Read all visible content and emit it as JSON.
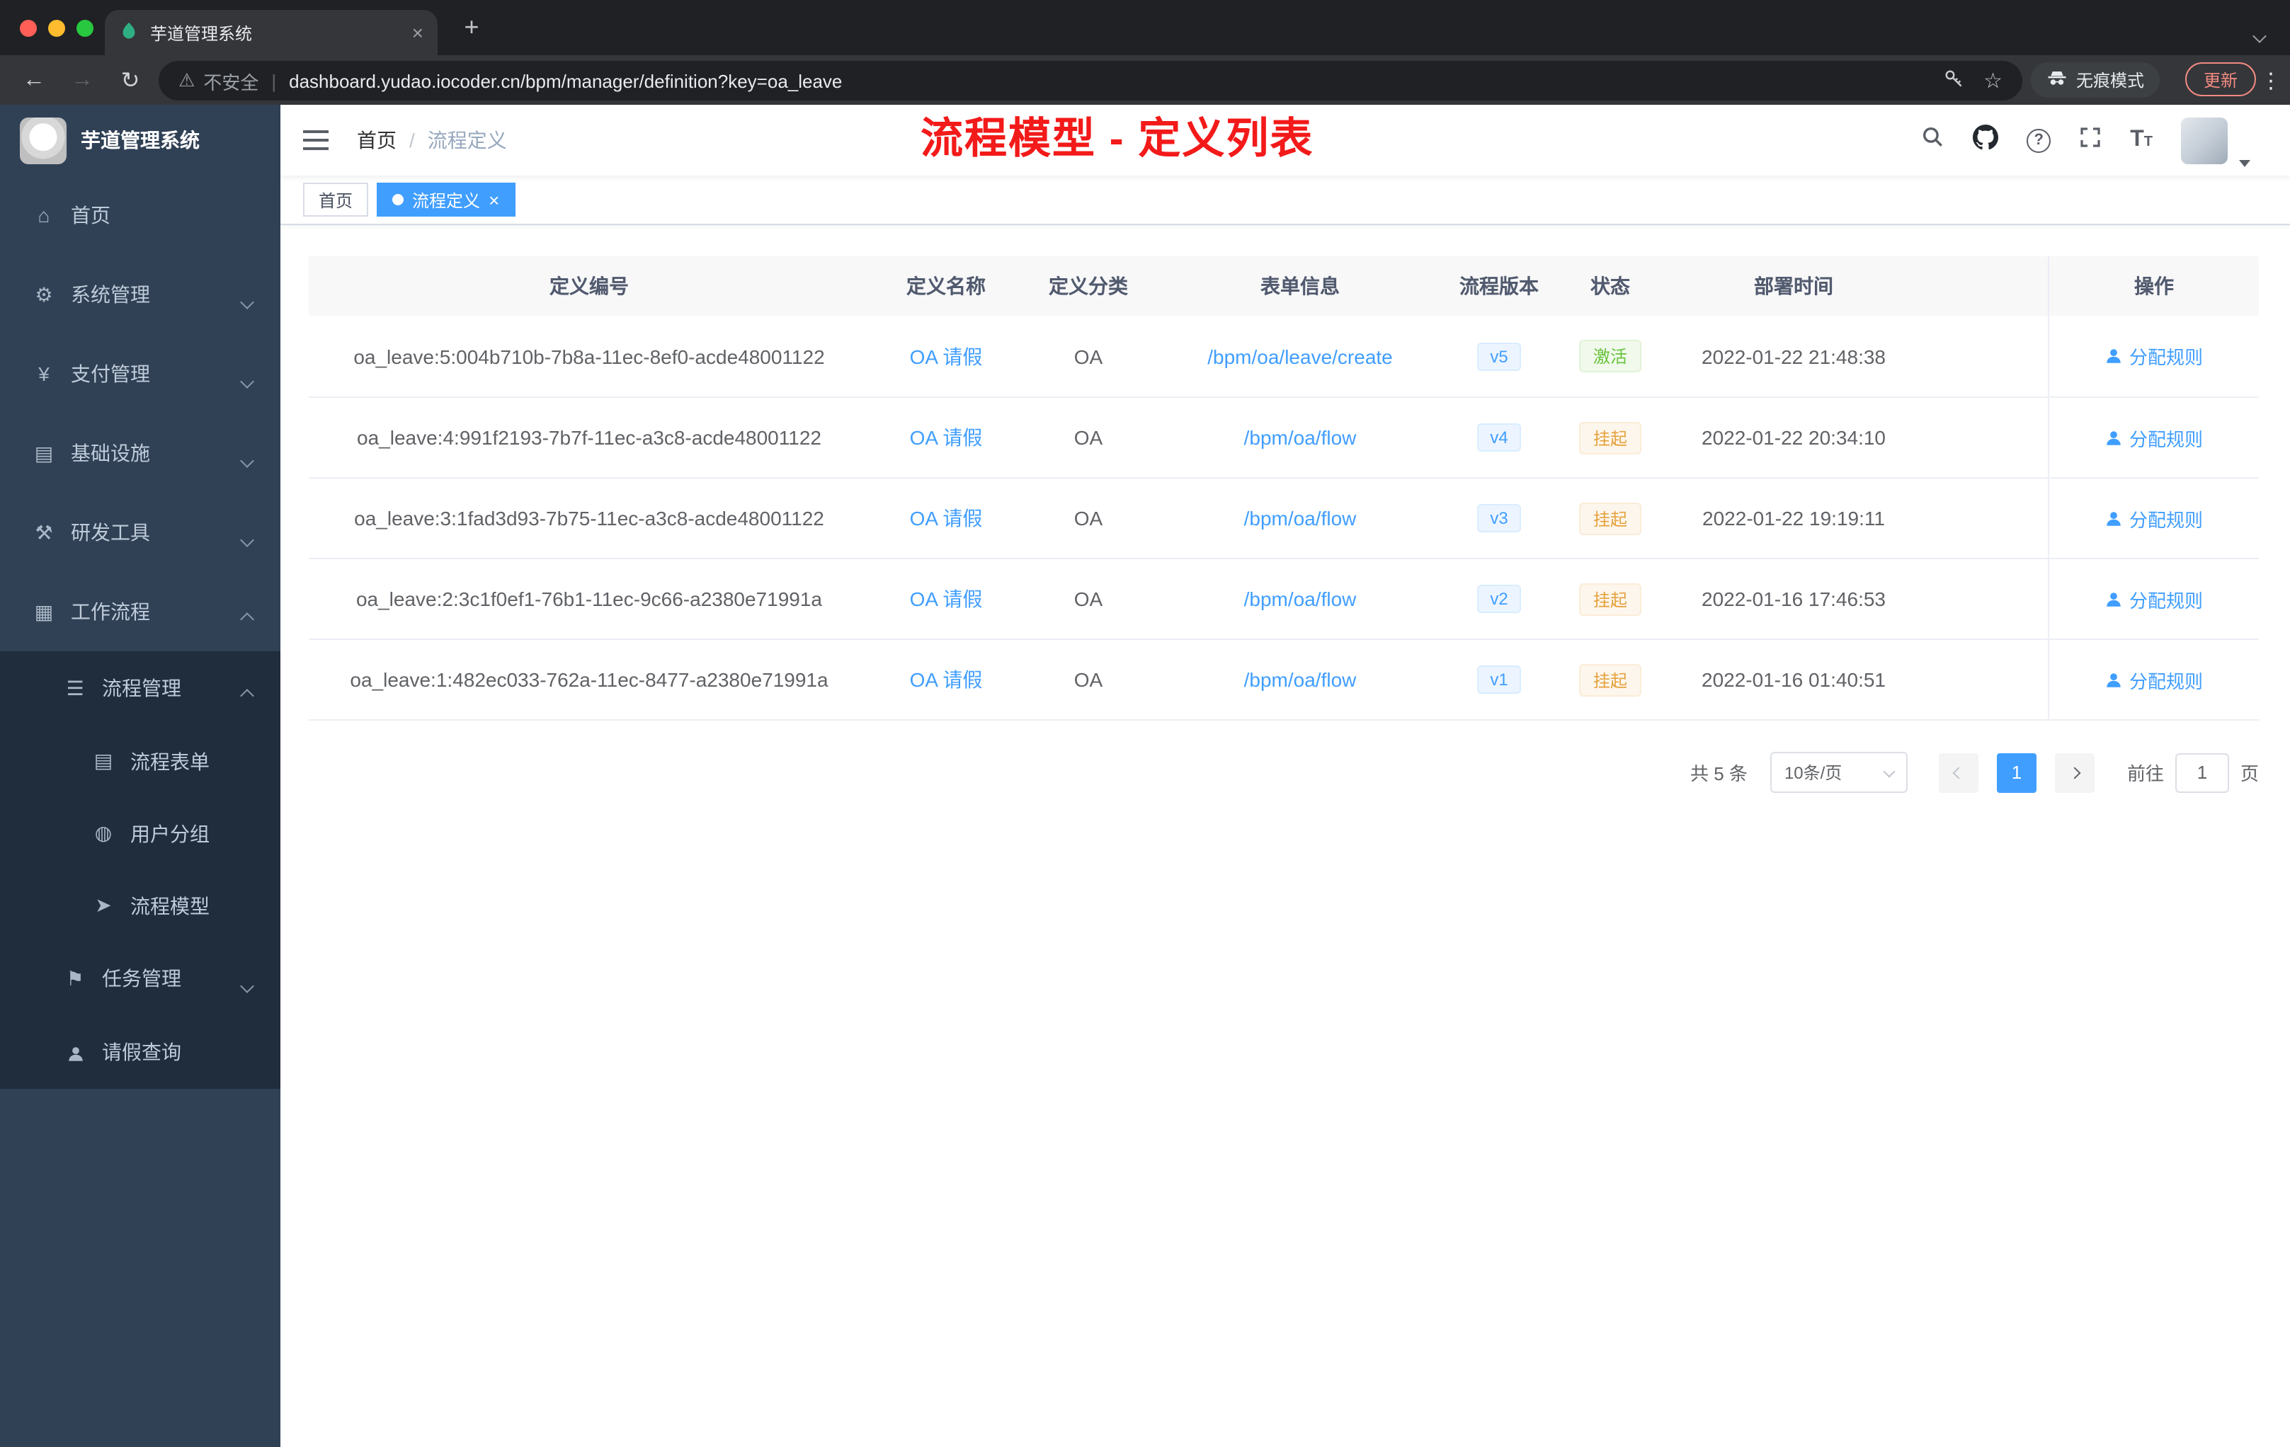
{
  "browser": {
    "tab_title": "芋道管理系统",
    "security_label": "不安全",
    "url": "dashboard.yudao.iocoder.cn/bpm/manager/definition?key=oa_leave",
    "incognito_label": "无痕模式",
    "update_label": "更新"
  },
  "sidebar": {
    "app_title": "芋道管理系统",
    "items": [
      {
        "key": "home",
        "label": "首页",
        "icon": "home-icon",
        "level": 1
      },
      {
        "key": "system",
        "label": "系统管理",
        "icon": "gear-icon",
        "level": 1,
        "arrow": "down"
      },
      {
        "key": "payment",
        "label": "支付管理",
        "icon": "payment-icon",
        "level": 1,
        "arrow": "down"
      },
      {
        "key": "infrastructure",
        "label": "基础设施",
        "icon": "infrastructure-icon",
        "level": 1,
        "arrow": "down"
      },
      {
        "key": "devtools",
        "label": "研发工具",
        "icon": "devtools-icon",
        "level": 1,
        "arrow": "down"
      },
      {
        "key": "workflow",
        "label": "工作流程",
        "icon": "workflow-icon",
        "level": 1,
        "arrow": "up"
      },
      {
        "key": "process-manage",
        "label": "流程管理",
        "icon": "process-manage-icon",
        "level": 2,
        "arrow": "up"
      },
      {
        "key": "process-form",
        "label": "流程表单",
        "icon": "form-icon",
        "level": 3
      },
      {
        "key": "user-group",
        "label": "用户分组",
        "icon": "user-group-icon",
        "level": 3
      },
      {
        "key": "process-model",
        "label": "流程模型",
        "icon": "model-icon",
        "level": 3
      },
      {
        "key": "task-manage",
        "label": "任务管理",
        "icon": "task-icon",
        "level": 2,
        "arrow": "down"
      },
      {
        "key": "leave-query",
        "label": "请假查询",
        "icon": "person-icon",
        "level": 2
      }
    ]
  },
  "header": {
    "breadcrumb_home": "首页",
    "breadcrumb_sep": "/",
    "breadcrumb_current": "流程定义",
    "annotation_title": "流程模型 - 定义列表"
  },
  "tags": [
    {
      "key": "home",
      "label": "首页",
      "active": false,
      "closable": false
    },
    {
      "key": "process-definition",
      "label": "流程定义",
      "active": true,
      "closable": true
    }
  ],
  "table": {
    "columns": [
      "定义编号",
      "定义名称",
      "定义分类",
      "表单信息",
      "流程版本",
      "状态",
      "部署时间",
      "操作"
    ],
    "action_label": "分配规则",
    "rows": [
      {
        "id": "oa_leave:5:004b710b-7b8a-11ec-8ef0-acde48001122",
        "name": "OA 请假",
        "category": "OA",
        "form": "/bpm/oa/leave/create",
        "version": "v5",
        "status": "激活",
        "status_type": "active",
        "time": "2022-01-22 21:48:38"
      },
      {
        "id": "oa_leave:4:991f2193-7b7f-11ec-a3c8-acde48001122",
        "name": "OA 请假",
        "category": "OA",
        "form": "/bpm/oa/flow",
        "version": "v4",
        "status": "挂起",
        "status_type": "suspended",
        "time": "2022-01-22 20:34:10"
      },
      {
        "id": "oa_leave:3:1fad3d93-7b75-11ec-a3c8-acde48001122",
        "name": "OA 请假",
        "category": "OA",
        "form": "/bpm/oa/flow",
        "version": "v3",
        "status": "挂起",
        "status_type": "suspended",
        "time": "2022-01-22 19:19:11"
      },
      {
        "id": "oa_leave:2:3c1f0ef1-76b1-11ec-9c66-a2380e71991a",
        "name": "OA 请假",
        "category": "OA",
        "form": "/bpm/oa/flow",
        "version": "v2",
        "status": "挂起",
        "status_type": "suspended",
        "time": "2022-01-16 17:46:53"
      },
      {
        "id": "oa_leave:1:482ec033-762a-11ec-8477-a2380e71991a",
        "name": "OA 请假",
        "category": "OA",
        "form": "/bpm/oa/flow",
        "version": "v1",
        "status": "挂起",
        "status_type": "suspended",
        "time": "2022-01-16 01:40:51"
      }
    ]
  },
  "pagination": {
    "total_label": "共 5 条",
    "page_size_label": "10条/页",
    "current_page": "1",
    "goto_label": "前往",
    "goto_value": "1",
    "page_unit": "页"
  },
  "colors": {
    "accent": "#409eff",
    "status_active": "#67c23a",
    "status_suspended": "#e6a23c",
    "annotation_red": "#f31a1a",
    "sidebar_bg": "#304156",
    "sidebar_sub_bg": "#1f2d3d"
  }
}
